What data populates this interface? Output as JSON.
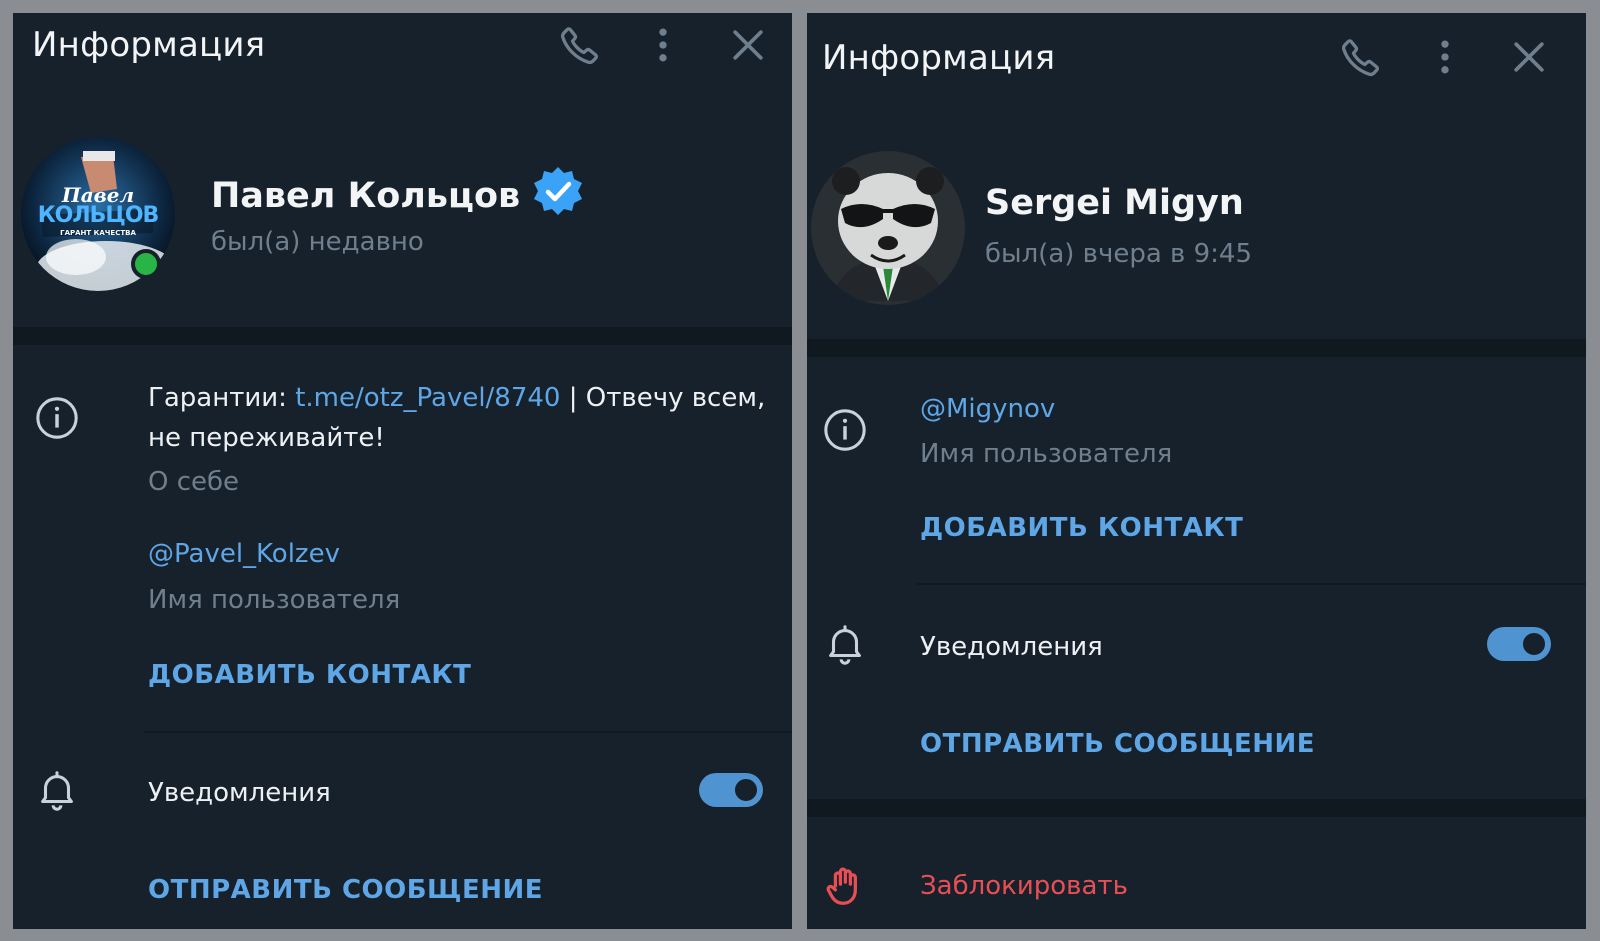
{
  "colors": {
    "panel_bg": "#17212b",
    "accent": "#5ea6e6",
    "muted": "#6f7f8d",
    "danger": "#e84f55",
    "online": "#29b446"
  },
  "left": {
    "header": {
      "title": "Информация",
      "icons": [
        "phone-icon",
        "more-vertical-icon",
        "close-icon"
      ]
    },
    "profile": {
      "name": "Павел Кольцов",
      "status": "был(а) недавно",
      "verified": true,
      "online": true,
      "avatar_text_line1": "Павел",
      "avatar_text_line2": "КОЛЬЦОВ",
      "avatar_text_line3": "ГАРАНТ КАЧЕСТВА"
    },
    "bio": {
      "prefix": "Гарантии: ",
      "link": "t.me/otz_Pavel/8740",
      "suffix": " | Отвечу всем,",
      "line2": "не переживайте!",
      "label": "О себе"
    },
    "username": {
      "value": "@Pavel_Kolzev",
      "label": "Имя пользователя"
    },
    "add_contact": "ДОБАВИТЬ КОНТАКТ",
    "notifications": {
      "label": "Уведомления",
      "enabled": true
    },
    "send_message": "ОТПРАВИТЬ СООБЩЕНИЕ"
  },
  "right": {
    "header": {
      "title": "Информация",
      "icons": [
        "phone-icon",
        "more-vertical-icon",
        "close-icon"
      ]
    },
    "profile": {
      "name": "Sergei Migyn",
      "status": "был(а) вчера в 9:45"
    },
    "username": {
      "value": "@Migynov",
      "label": "Имя пользователя"
    },
    "add_contact": "ДОБАВИТЬ КОНТАКТ",
    "notifications": {
      "label": "Уведомления",
      "enabled": true
    },
    "send_message": "ОТПРАВИТЬ СООБЩЕНИЕ",
    "block": "Заблокировать"
  }
}
